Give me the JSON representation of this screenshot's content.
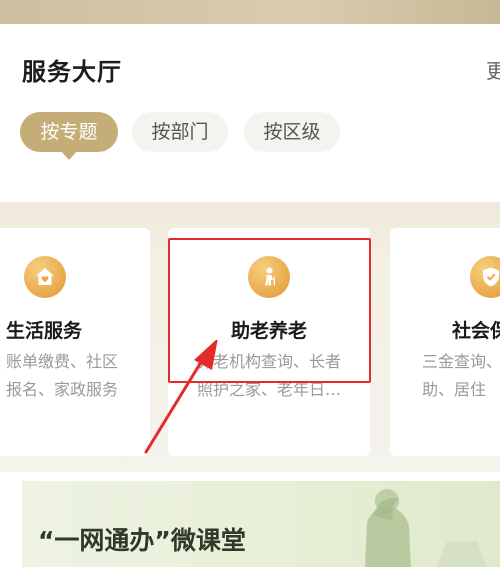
{
  "hall": {
    "title": "服务大厅",
    "more": "更",
    "tabs": [
      {
        "label": "按专题",
        "active": true
      },
      {
        "label": "按部门",
        "active": false
      },
      {
        "label": "按区级",
        "active": false
      }
    ]
  },
  "cards": [
    {
      "title": "生活服务",
      "desc_line1": "账单缴费、社区",
      "desc_line2": "报名、家政服务",
      "icon": "home-heart-icon"
    },
    {
      "title": "助老养老",
      "desc_line1": "养老机构查询、长者",
      "desc_line2": "照护之家、老年日…",
      "icon": "elder-person-icon"
    },
    {
      "title": "社会保",
      "desc_line1": "三金查询、",
      "desc_line2": "助、居住",
      "icon": "shield-icon"
    }
  ],
  "banner": {
    "title": "“一网通办”微课堂"
  },
  "colors": {
    "accent_gold": "#c5ad77",
    "icon_orange": "#e9a74a",
    "highlight_red": "#e52a2a"
  }
}
